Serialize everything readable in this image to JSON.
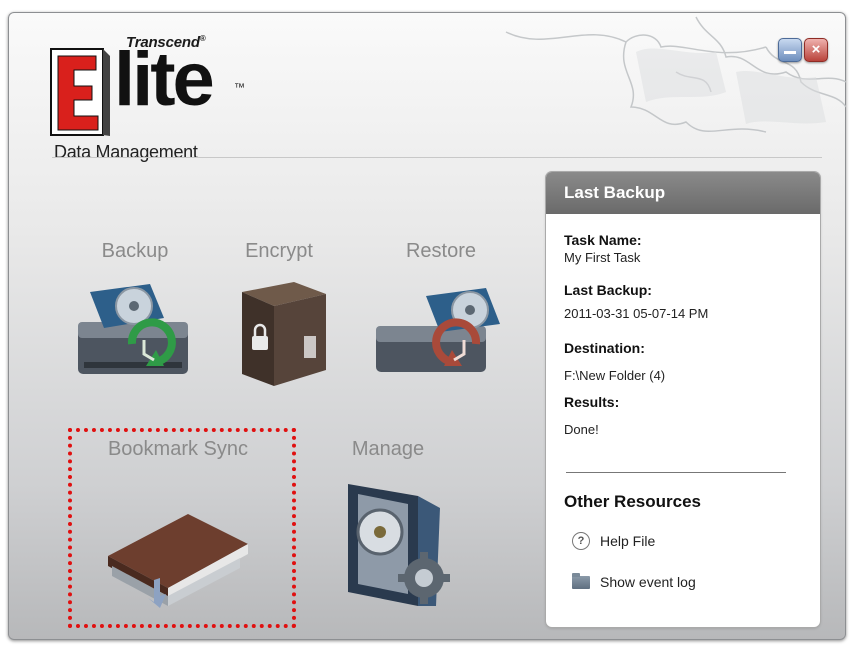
{
  "logo": {
    "brand": "Transcend",
    "brand_mark": "®",
    "product": "lite",
    "tm": "™",
    "subtitle": "Data Management"
  },
  "window_controls": {
    "close_glyph": "×"
  },
  "features": [
    {
      "label": "Backup"
    },
    {
      "label": "Encrypt"
    },
    {
      "label": "Restore"
    },
    {
      "label": "Bookmark Sync"
    },
    {
      "label": "Manage"
    }
  ],
  "last_backup": {
    "header": "Last Backup",
    "task_name_label": "Task Name:",
    "task_name_value": "My First Task",
    "last_backup_label": "Last Backup:",
    "last_backup_value": "2011-03-31 05-07-14 PM",
    "destination_label": "Destination:",
    "destination_value": "F:\\New Folder (4)",
    "results_label": "Results:",
    "results_value": "Done!"
  },
  "other_resources": {
    "title": "Other Resources",
    "items": [
      {
        "label": "Help File",
        "icon": "help-icon"
      },
      {
        "label": "Show event log",
        "icon": "folder-icon"
      }
    ]
  },
  "colors": {
    "highlight_border": "#e01010",
    "panel_header": "#7a7a7a",
    "logo_red": "#d9201c"
  }
}
